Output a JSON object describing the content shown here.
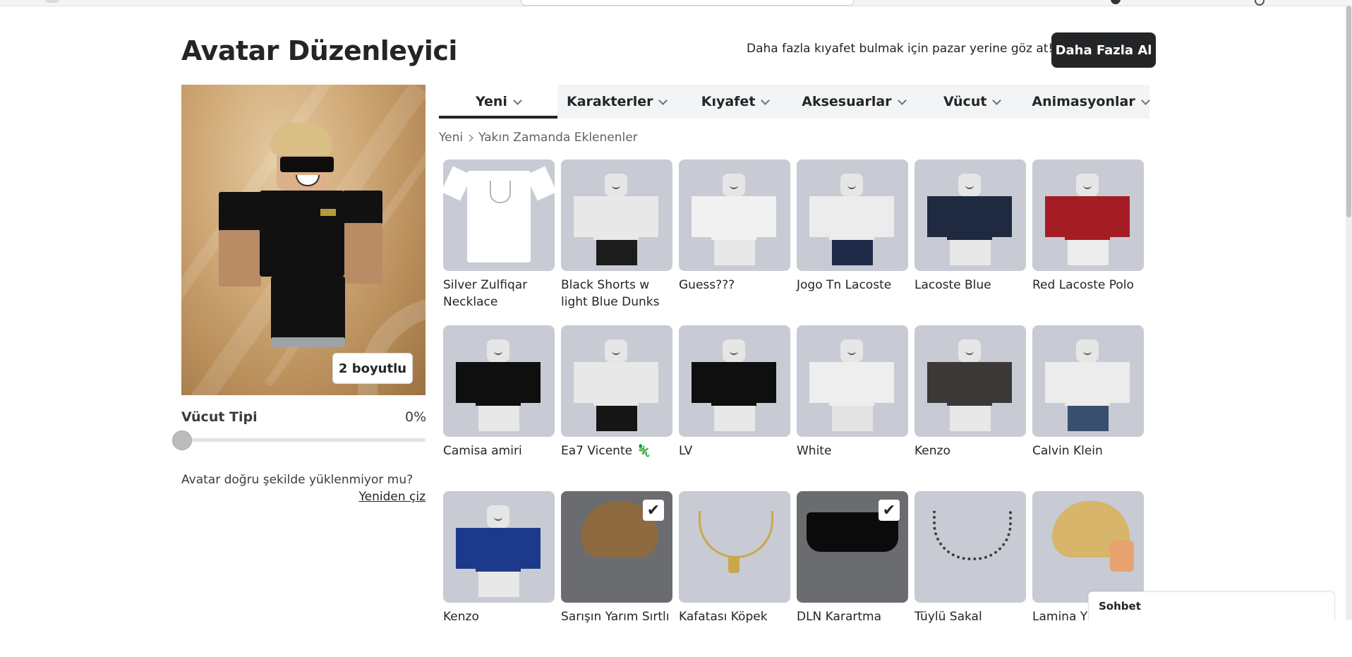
{
  "header": {
    "title": "Avatar Düzenleyici",
    "shop_text": "Daha fazla kıyafet bulmak için pazar yerine göz at!",
    "shop_button": "Daha Fazla Al"
  },
  "preview": {
    "dimension_button": "2 boyutlu",
    "body_type_label": "Vücut Tipi",
    "body_type_value": "0%",
    "body_type_fraction": 0,
    "reload_question": "Avatar doğru şekilde yüklenmiyor mu?",
    "reload_link": "Yeniden çiz"
  },
  "tabs": [
    {
      "label": "Yeni",
      "active": true
    },
    {
      "label": "Karakterler",
      "active": false
    },
    {
      "label": "Kıyafet",
      "active": false
    },
    {
      "label": "Aksesuarlar",
      "active": false
    },
    {
      "label": "Vücut",
      "active": false
    },
    {
      "label": "Animasyonlar",
      "active": false
    }
  ],
  "breadcrumb": {
    "root": "Yeni",
    "current": "Yakın Zamanda Eklenenler"
  },
  "items": [
    {
      "name": "Silver Zulfiqar Necklace",
      "kind": "tshirt",
      "selected": false
    },
    {
      "name": "Black Shorts w light Blue Dunks",
      "kind": "mannequin",
      "shirt": "#e8e8e8",
      "pants": "#1c1c1c",
      "selected": false
    },
    {
      "name": "Guess???",
      "kind": "mannequin",
      "shirt": "#f1f1f1",
      "pants": "#e8e8e8",
      "selected": false
    },
    {
      "name": "Jogo Tn Lacoste",
      "kind": "mannequin",
      "shirt": "#ececec",
      "pants": "#1e2a48",
      "selected": false
    },
    {
      "name": "Lacoste Blue",
      "kind": "mannequin",
      "shirt": "#1f2940",
      "pants": "#e8e8e8",
      "selected": false
    },
    {
      "name": "Red Lacoste Polo",
      "kind": "mannequin",
      "shirt": "#a51d24",
      "pants": "#ececec",
      "selected": false
    },
    {
      "name": "Camisa amiri",
      "kind": "mannequin",
      "shirt": "#0f0f0f",
      "pants": "#e8e8e8",
      "selected": false
    },
    {
      "name": "Ea7 Vicente 🦎",
      "kind": "mannequin",
      "shirt": "#e8e8e8",
      "pants": "#151515",
      "selected": false
    },
    {
      "name": "LV",
      "kind": "mannequin",
      "shirt": "#0f0f0f",
      "pants": "#e8e8e8",
      "selected": false
    },
    {
      "name": "White",
      "kind": "mannequin",
      "shirt": "#eeeeee",
      "pants": "#e3e3e3",
      "selected": false
    },
    {
      "name": "Kenzo",
      "kind": "mannequin",
      "shirt": "#3b3838",
      "pants": "#e8e8e8",
      "selected": false
    },
    {
      "name": "Calvin Klein",
      "kind": "mannequin",
      "shirt": "#ececec",
      "pants": "#3a4f6e",
      "selected": false
    },
    {
      "name": "Kenzo",
      "kind": "mannequin",
      "shirt": "#1d3a8a",
      "pants": "#e8e8e8",
      "selected": false
    },
    {
      "name": "Sarışın Yarım Sırtlı",
      "kind": "hair",
      "color": "#8d6a3f",
      "selected": true
    },
    {
      "name": "Kafatası Köpek",
      "kind": "necklace",
      "selected": false
    },
    {
      "name": "DLN Karartma",
      "kind": "glasses",
      "selected": true
    },
    {
      "name": "Tüylü Sakal",
      "kind": "beard",
      "selected": false
    },
    {
      "name": "Lamina Y",
      "kind": "hair",
      "color": "#d7b56a",
      "selected": false
    }
  ],
  "chat": {
    "label": "Sohbet"
  }
}
